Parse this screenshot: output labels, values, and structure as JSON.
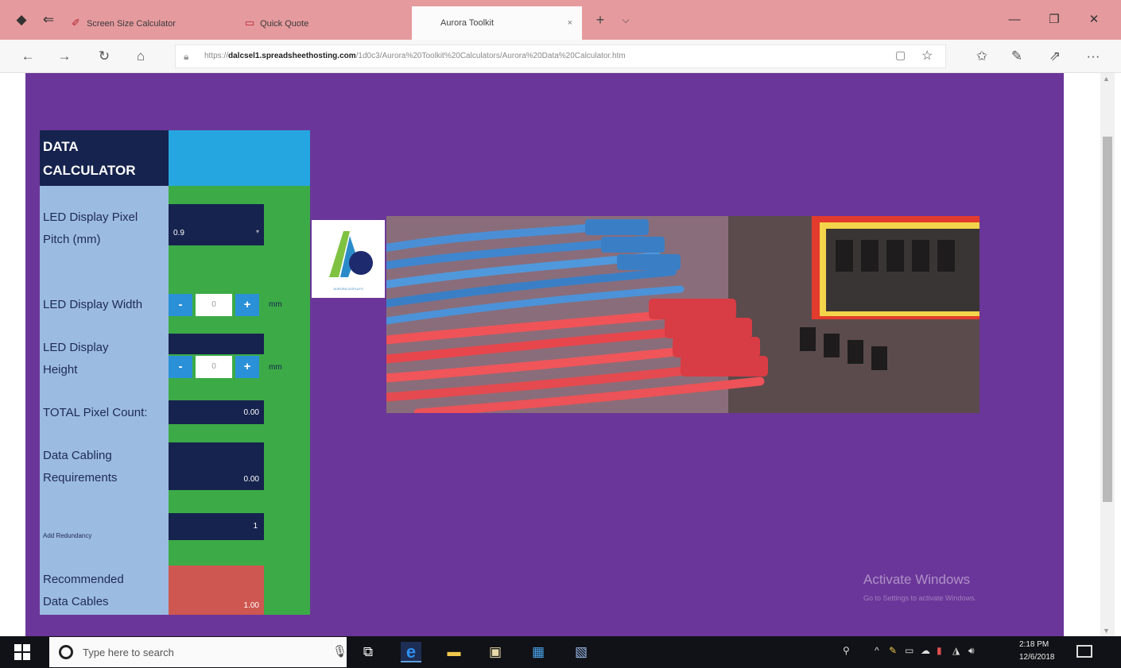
{
  "browser": {
    "tabs": [
      {
        "label": "Screen Size Calculator",
        "active": false
      },
      {
        "label": "Quick Quote",
        "active": false
      },
      {
        "label": "Aurora Toolkit",
        "active": true
      }
    ],
    "new_tab_symbol": "+",
    "tab_list_symbol": "⌵",
    "close_tab_symbol": "×",
    "window_controls": {
      "minimize": "—",
      "maximize": "❐",
      "close": "✕"
    },
    "nav": {
      "back": "←",
      "forward": "→",
      "refresh": "↻",
      "home": "⌂"
    },
    "url_host": "dalcsel1.spreadsheethosting.com",
    "url_prefix": "https://",
    "url_rest": "/1d0c3/Aurora%20Toolkit%20Calculators/Aurora%20Data%20Calculator.htm",
    "toolbar_icons": {
      "favorites": "☆",
      "collections": "✩",
      "pen": "✎",
      "share": "⇗",
      "more": "···"
    }
  },
  "calculator": {
    "title_line1": "DATA",
    "title_line2": "CALCULATOR",
    "pixel_pitch": {
      "label_line1": "LED Display Pixel",
      "label_line2": "Pitch (mm)",
      "value": "0.9"
    },
    "width": {
      "label": "LED Display Width",
      "minus": "-",
      "plus": "+",
      "value": "0",
      "unit": "mm"
    },
    "height": {
      "label_line1": "LED Display",
      "label_line2": "Height",
      "minus": "-",
      "plus": "+",
      "value": "0",
      "unit": "mm"
    },
    "total_pixels": {
      "label": "TOTAL Pixel Count:",
      "value": "0.00"
    },
    "cabling": {
      "label_line1": "Data Cabling",
      "label_line2": "Requirements",
      "value": "0.00"
    },
    "redundancy": {
      "label": "Add Redundancy",
      "value": "1"
    },
    "recommended": {
      "label_line1": "Recommended",
      "label_line2": "Data Cables",
      "value": "1.00"
    }
  },
  "logo_caption": "AURORA DISPLAYS",
  "watermark": {
    "title": "Activate Windows",
    "subtitle": "Go to Settings to activate Windows."
  },
  "taskbar": {
    "search_placeholder": "Type here to search",
    "time": "2:18 PM",
    "date": "12/6/2018"
  },
  "colors": {
    "page_bg": "#6b3699",
    "calc_green": "#3cab47",
    "calc_navy": "#16234e",
    "calc_blue": "#26a6e0",
    "label_col": "#9cbbe0",
    "recommended": "#cf5751"
  }
}
